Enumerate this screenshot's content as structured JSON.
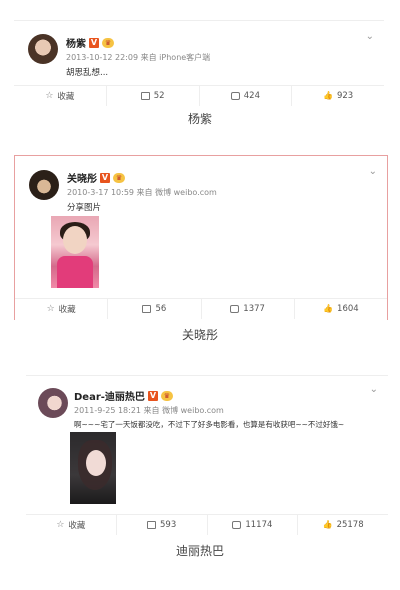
{
  "posts": [
    {
      "name": "杨紫",
      "time": "2013-10-12 22:09",
      "source": "来自 iPhone客户端",
      "text": "胡思乱想...",
      "actions": {
        "fav": "收藏",
        "repost": "52",
        "comment": "424",
        "like": "923"
      },
      "caption": "杨紫"
    },
    {
      "name": "关晓彤",
      "time": "2010-3-17 10:59",
      "source": "来自 微博 weibo.com",
      "text": "分享图片",
      "actions": {
        "fav": "收藏",
        "repost": "56",
        "comment": "1377",
        "like": "1604"
      },
      "caption": "关晓彤"
    },
    {
      "name": "Dear-迪丽热巴",
      "time": "2011-9-25 18:21",
      "source": "来自 微博 weibo.com",
      "text": "啊~~~宅了一天饭都没吃，不过下了好多电影看，也算是有收获吧~~不过好饿~",
      "actions": {
        "fav": "收藏",
        "repost": "593",
        "comment": "11174",
        "like": "25178"
      },
      "caption": "迪丽热巴"
    }
  ],
  "badges": {
    "v": "V",
    "r": "♛"
  },
  "icons": {
    "star": "☆",
    "like": "👍"
  }
}
